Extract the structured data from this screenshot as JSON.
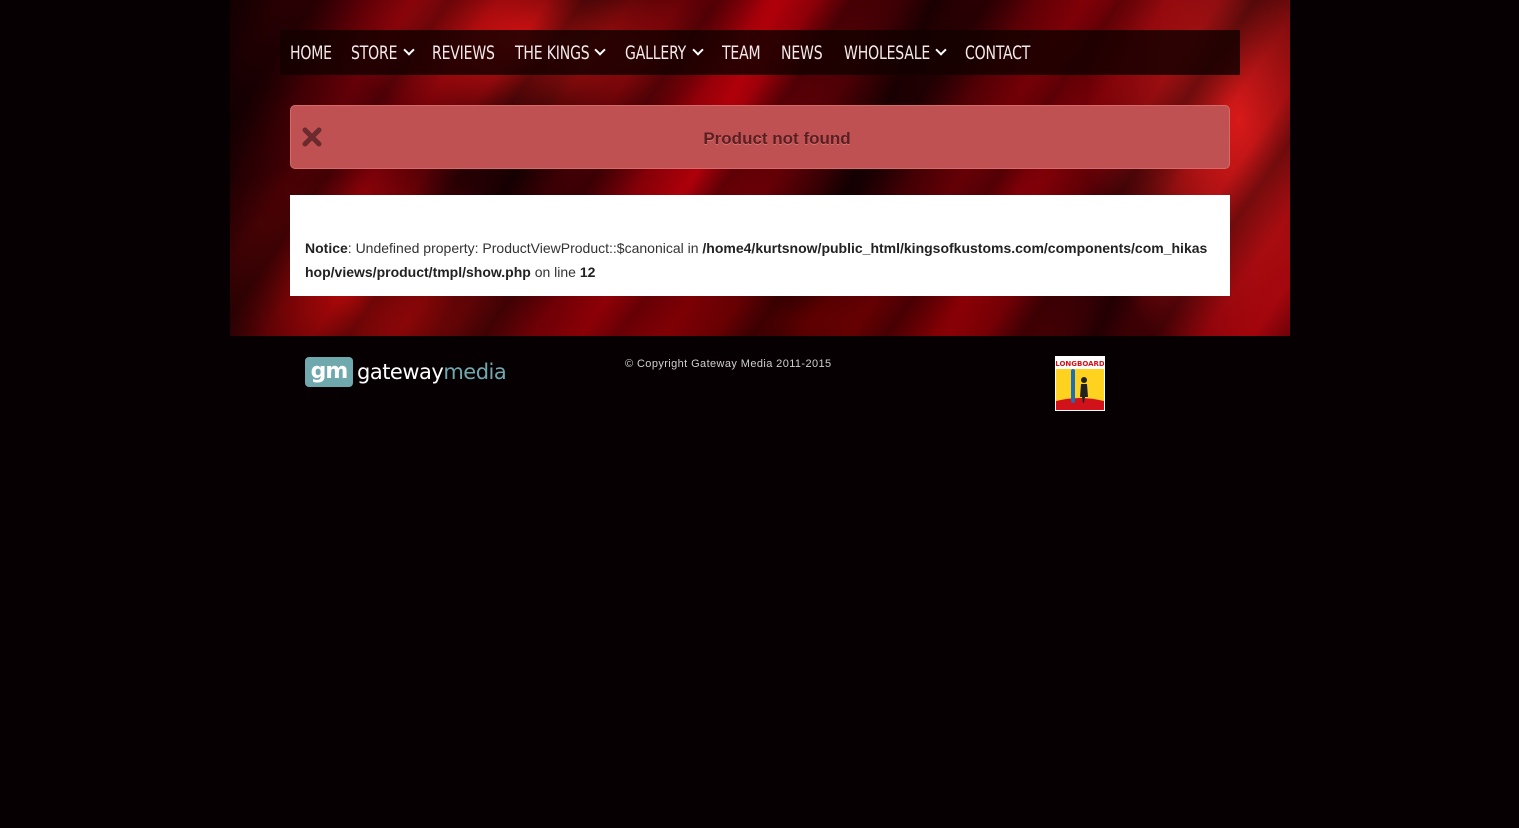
{
  "nav": {
    "items": [
      {
        "label": "HOME",
        "dropdown": false
      },
      {
        "label": "STORE",
        "dropdown": true
      },
      {
        "label": "REVIEWS",
        "dropdown": false
      },
      {
        "label": "THE KINGS",
        "dropdown": true
      },
      {
        "label": "GALLERY",
        "dropdown": true
      },
      {
        "label": "TEAM",
        "dropdown": false
      },
      {
        "label": "NEWS",
        "dropdown": false
      },
      {
        "label": "WHOLESALE",
        "dropdown": true
      },
      {
        "label": "CONTACT",
        "dropdown": false
      }
    ]
  },
  "alert": {
    "message": "Product not found",
    "icon": "close-icon"
  },
  "notice": {
    "label": "Notice",
    "text1": ": Undefined property: ProductViewProduct::$canonical in ",
    "path": "/home4/kurtsnow/public_html/kingsofkustoms.com/components/com_hikashop/views/product/tmpl/show.php",
    "text2": " on line ",
    "line": "12"
  },
  "footer": {
    "logo_gm": "gm",
    "logo_word1": "gateway",
    "logo_word2": "media",
    "copyright": "© Copyright Gateway Media 2011-2015",
    "badge_text": "LONGBOARD"
  },
  "colors": {
    "background": "#060002",
    "alert_bg": "#bf5152",
    "alert_text": "#5a1f22",
    "logo_accent": "#6fa8ad"
  }
}
